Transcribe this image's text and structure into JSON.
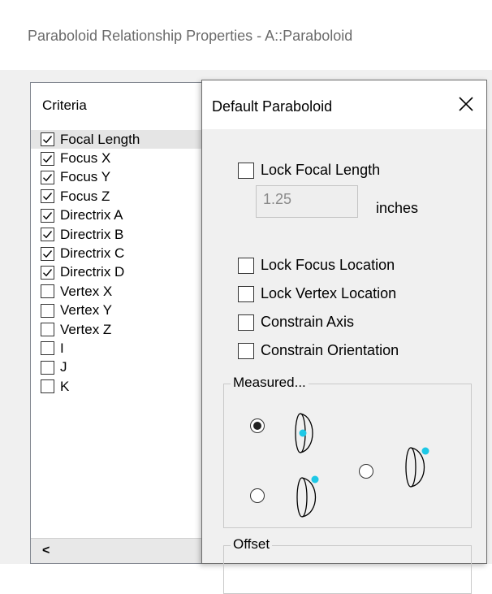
{
  "window": {
    "title": "Paraboloid Relationship Properties - A::Paraboloid"
  },
  "criteria": {
    "header": "Criteria",
    "items": [
      {
        "label": "Focal Length",
        "checked": true,
        "selected": true
      },
      {
        "label": "Focus X",
        "checked": true
      },
      {
        "label": "Focus Y",
        "checked": true
      },
      {
        "label": "Focus Z",
        "checked": true
      },
      {
        "label": "Directrix A",
        "checked": true
      },
      {
        "label": "Directrix B",
        "checked": true
      },
      {
        "label": "Directrix C",
        "checked": true
      },
      {
        "label": "Directrix D",
        "checked": true
      },
      {
        "label": "Vertex X",
        "checked": false
      },
      {
        "label": "Vertex Y",
        "checked": false
      },
      {
        "label": "Vertex Z",
        "checked": false
      },
      {
        "label": "I",
        "checked": false
      },
      {
        "label": "J",
        "checked": false
      },
      {
        "label": "K",
        "checked": false
      }
    ],
    "scroll_left": "<"
  },
  "dialog": {
    "title": "Default Paraboloid",
    "close_icon": "close-icon",
    "lock_focal_length": {
      "label": "Lock Focal Length",
      "checked": false
    },
    "focal_length_value": "1.25",
    "focal_length_unit": "inches",
    "lock_focus_location": {
      "label": "Lock Focus Location",
      "checked": false
    },
    "lock_vertex_location": {
      "label": "Lock Vertex Location",
      "checked": false
    },
    "constrain_axis": {
      "label": "Constrain Axis",
      "checked": false
    },
    "constrain_orientation": {
      "label": "Constrain Orientation",
      "checked": false
    },
    "measured_group": {
      "legend": "Measured...",
      "options": [
        {
          "name": "measured-option-focus-on-face",
          "checked": true
        },
        {
          "name": "measured-option-focus-top-right",
          "checked": false
        },
        {
          "name": "measured-option-focus-top",
          "checked": false
        }
      ]
    },
    "offset_group": {
      "legend": "Offset"
    }
  },
  "colors": {
    "focus_marker": "#1ec8e6",
    "title_text": "#6b6b6b",
    "dialog_bg": "#f0f0f0"
  }
}
